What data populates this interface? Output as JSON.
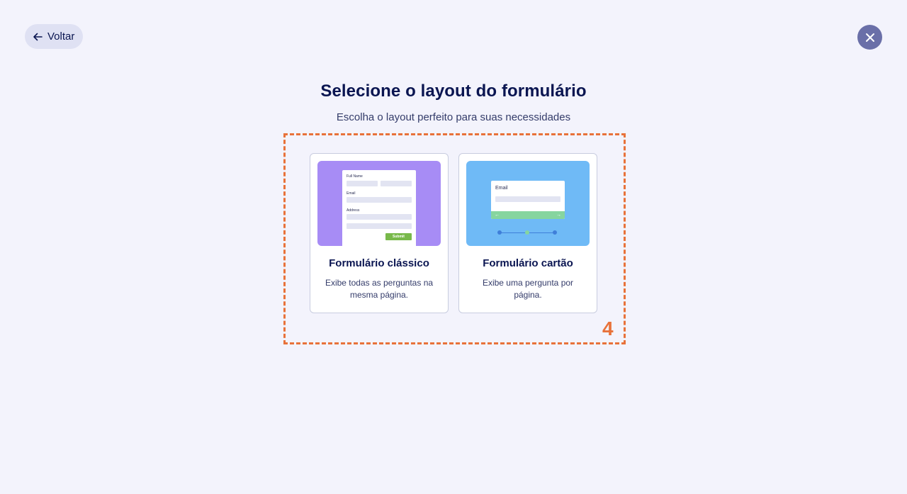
{
  "header": {
    "back_label": "Voltar",
    "back_icon": "arrow-left-icon",
    "close_icon": "close-icon"
  },
  "main": {
    "title": "Selecione o layout do formulário",
    "subtitle": "Escolha o layout perfeito para suas necessidades"
  },
  "annotation": {
    "number": "4",
    "color": "#e8723a"
  },
  "cards": [
    {
      "title": "Formulário clássico",
      "description": "Exibe todas as perguntas na mesma página.",
      "preview_color": "#a78cf5",
      "preview": {
        "full_name_label": "Full Name",
        "email_label": "Email",
        "address_label": "Address",
        "submit_label": "Submit"
      }
    },
    {
      "title": "Formulário cartão",
      "description": "Exibe uma pergunta por página.",
      "preview_color": "#6fbaf6",
      "preview": {
        "email_label": "Email",
        "prev_arrow": "←",
        "next_arrow": "→"
      }
    }
  ],
  "colors": {
    "background": "#f3f3fc",
    "text_primary": "#0a1551",
    "close_button": "#6a6fa8",
    "back_button": "#dfe1f3"
  }
}
